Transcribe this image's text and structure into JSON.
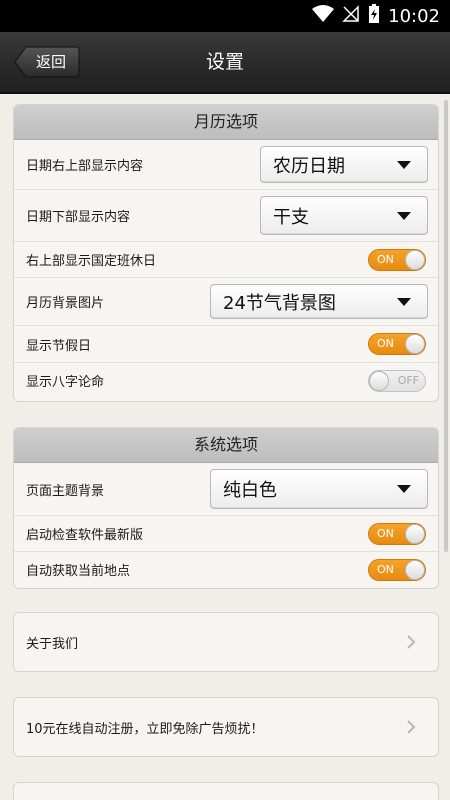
{
  "status": {
    "time": "10:02"
  },
  "header": {
    "back_label": "返回",
    "title": "设置"
  },
  "calendar_section": {
    "title": "月历选项",
    "rows": [
      {
        "label": "日期右上部显示内容",
        "type": "select",
        "value": "农历日期"
      },
      {
        "label": "日期下部显示内容",
        "type": "select",
        "value": "干支"
      },
      {
        "label": "右上部显示国定班休日",
        "type": "toggle",
        "state": "ON"
      },
      {
        "label": "月历背景图片",
        "type": "select",
        "value": "24节气背景图"
      },
      {
        "label": "显示节假日",
        "type": "toggle",
        "state": "ON"
      },
      {
        "label": "显示八字论命",
        "type": "toggle",
        "state": "OFF"
      }
    ]
  },
  "system_section": {
    "title": "系统选项",
    "rows": [
      {
        "label": "页面主题背景",
        "type": "select",
        "value": "纯白色"
      },
      {
        "label": "启动检查软件最新版",
        "type": "toggle",
        "state": "ON"
      },
      {
        "label": "自动获取当前地点",
        "type": "toggle",
        "state": "ON"
      }
    ]
  },
  "links": {
    "about": "关于我们",
    "register": "10元在线自动注册，立即免除广告烦扰！"
  },
  "colors": {
    "toggle_on": "#ee9418",
    "header_bar": "#2b2b2b"
  }
}
